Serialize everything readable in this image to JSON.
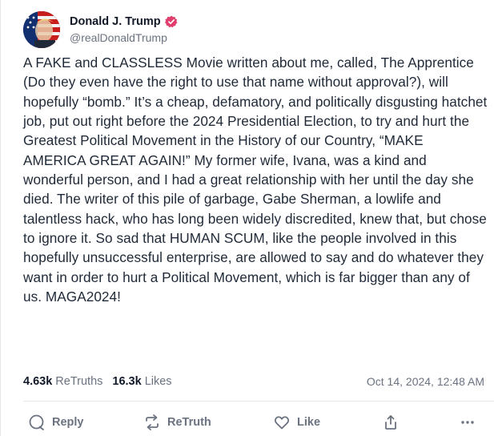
{
  "author": {
    "display_name": "Donald J. Trump",
    "handle": "@realDonaldTrump",
    "verified_icon": "verified-badge-icon",
    "avatar_colors": [
      "#0b2a6b",
      "#dc2626",
      "#ffffff"
    ]
  },
  "post": {
    "text": "A FAKE and CLASSLESS Movie written about me, called, The Apprentice (Do they even have the right to use that name without approval?), will hopefully “bomb.” It’s a cheap, defamatory, and politically disgusting hatchet job, put out right before the 2024 Presidential Election, to try and hurt the Greatest Political Movement in the History of our Country, “MAKE AMERICA GREAT AGAIN!” My former wife, Ivana, was a kind and wonderful person, and I had a great relationship with her until the day she died. The writer of this pile of garbage, Gabe Sherman, a lowlife and talentless hack, who has long been widely discredited, knew that, but chose to ignore it. So sad that HUMAN SCUM, like the people involved in this hopefully unsuccessful enterprise, are allowed to say and do whatever they want in order to hurt a Political Movement, which is far bigger than any of us. MAGA2024!"
  },
  "stats": {
    "retruths_count": "4.63k",
    "retruths_label": "ReTruths",
    "likes_count": "16.3k",
    "likes_label": "Likes",
    "timestamp": "Oct 14, 2024, 12:48 AM"
  },
  "actions": {
    "reply_label": "Reply",
    "retruth_label": "ReTruth",
    "like_label": "Like"
  },
  "colors": {
    "text": "#1f2937",
    "muted": "#6b7280",
    "verified": "#e03e6c",
    "divider": "#e5e7eb"
  }
}
